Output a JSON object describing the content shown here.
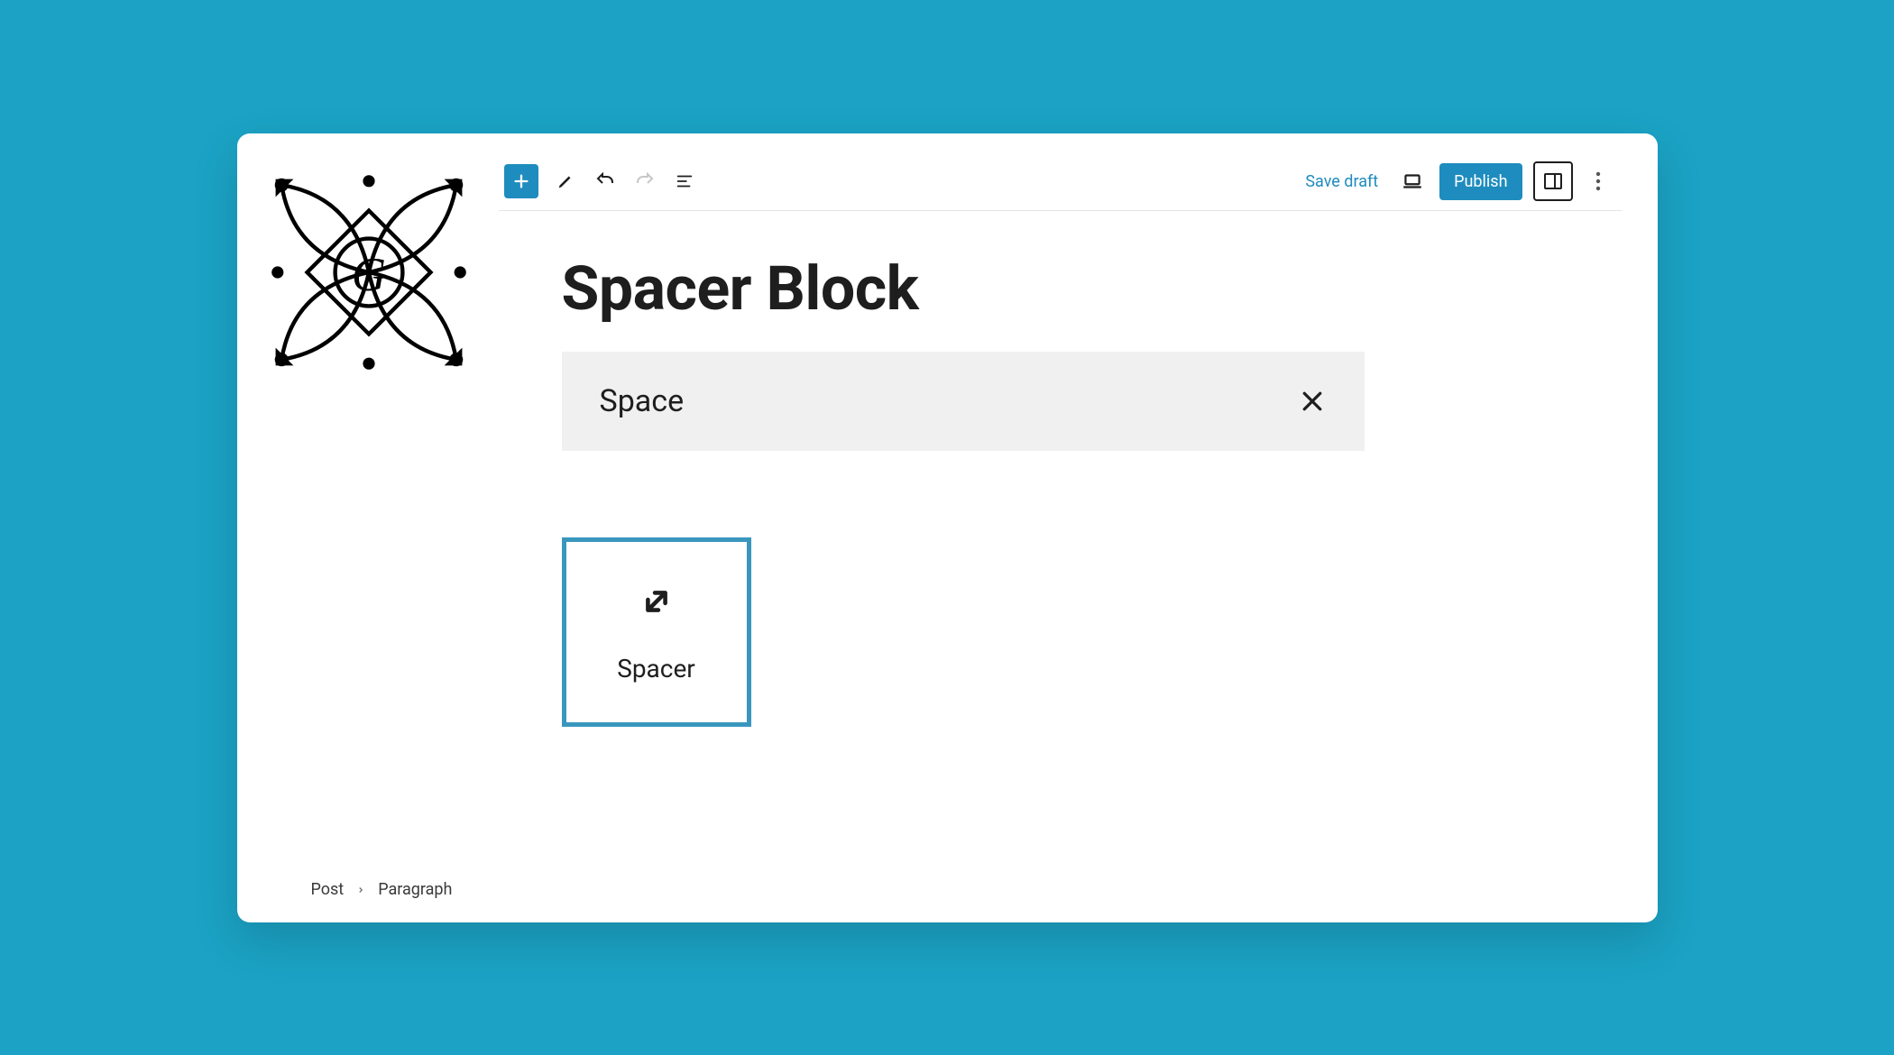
{
  "toolbar": {
    "save_draft": "Save draft",
    "publish": "Publish"
  },
  "page": {
    "title": "Spacer Block"
  },
  "search": {
    "query": "Space",
    "close_icon": "close-icon"
  },
  "blocks": [
    {
      "label": "Spacer",
      "icon": "resize-icon"
    }
  ],
  "breadcrumb": {
    "root": "Post",
    "current": "Paragraph"
  }
}
